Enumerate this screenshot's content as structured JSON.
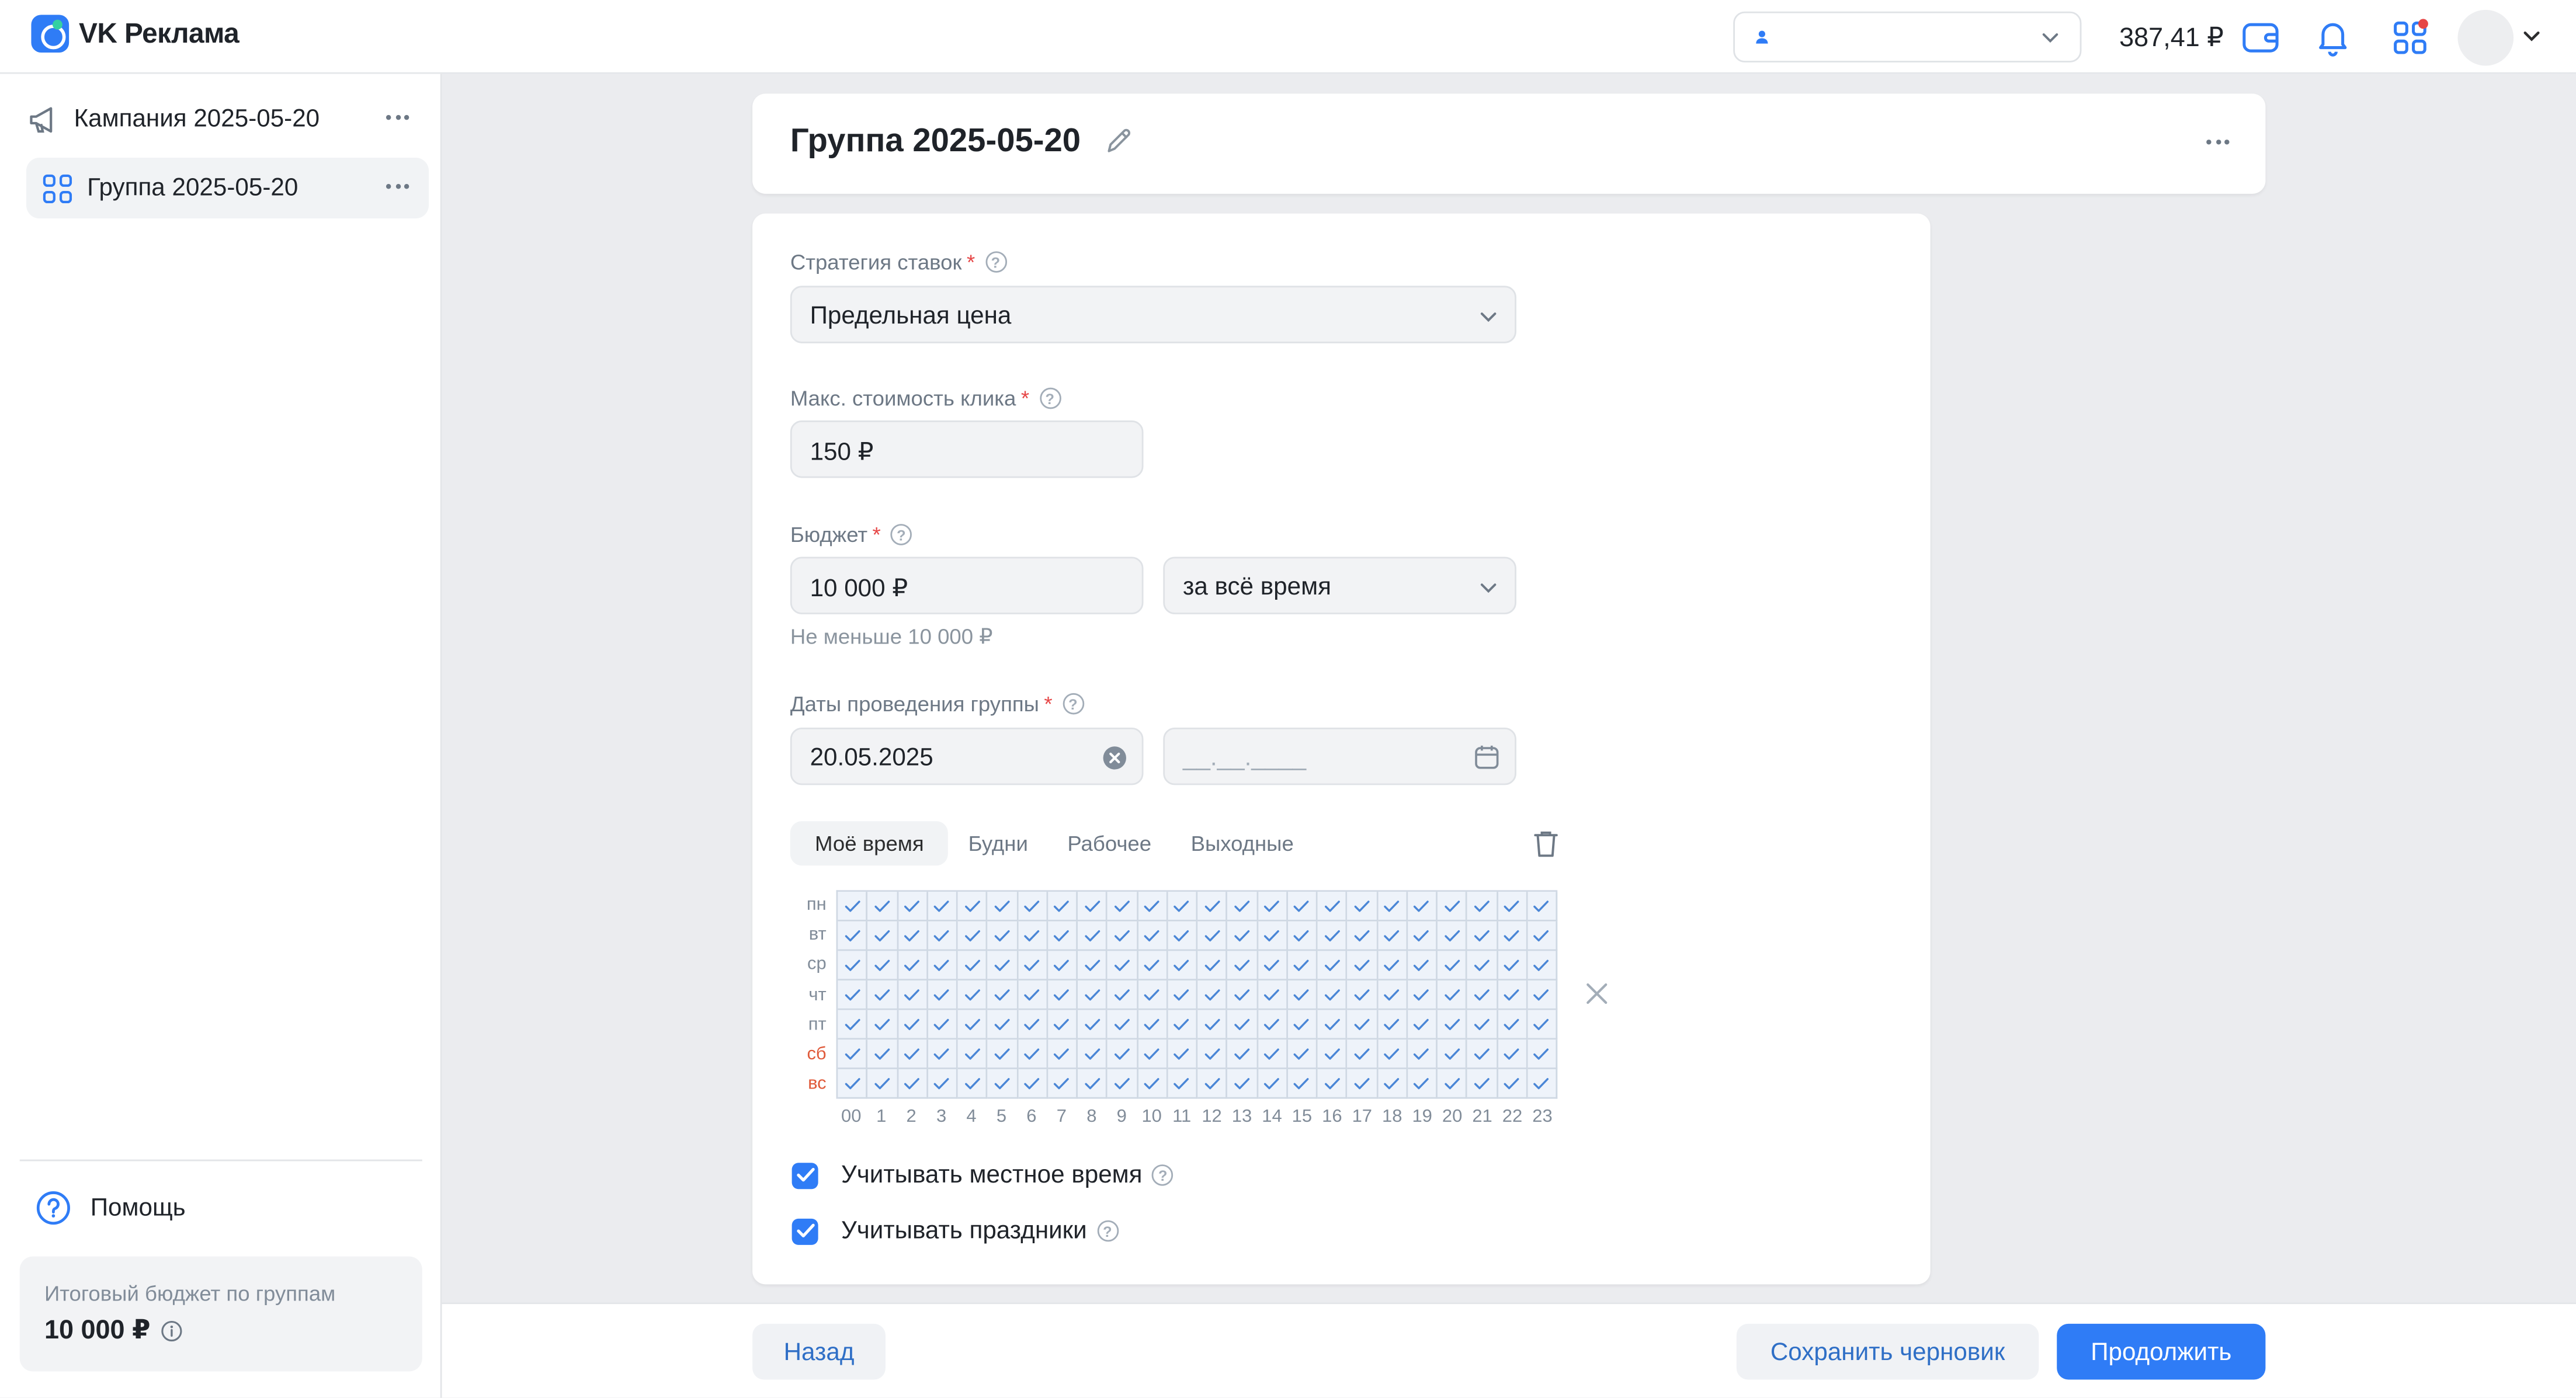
{
  "header": {
    "logo_text": "VK Реклама",
    "balance": "387,41 ₽"
  },
  "sidebar": {
    "items": [
      {
        "label": "Кампания 2025-05-20"
      },
      {
        "label": "Группа 2025-05-20"
      }
    ],
    "help_label": "Помощь",
    "budget_title": "Итоговый бюджет по группам",
    "budget_value": "10 000 ₽"
  },
  "main": {
    "group_title": "Группа 2025-05-20",
    "strategy": {
      "label": "Стратегия ставок",
      "value": "Предельная цена"
    },
    "max_click": {
      "label": "Макс. стоимость клика",
      "value": "150 ₽"
    },
    "budget": {
      "label": "Бюджет",
      "value": "10 000 ₽",
      "period": "за всё время",
      "hint": "Не меньше 10 000 ₽"
    },
    "dates": {
      "label": "Даты проведения группы",
      "start": "20.05.2025",
      "end_placeholder": "__.__.____"
    },
    "schedule_tabs": [
      "Моё время",
      "Будни",
      "Рабочее",
      "Выходные"
    ],
    "days": [
      "пн",
      "вт",
      "ср",
      "чт",
      "пт",
      "сб",
      "вс"
    ],
    "hours": [
      "00",
      "1",
      "2",
      "3",
      "4",
      "5",
      "6",
      "7",
      "8",
      "9",
      "10",
      "11",
      "12",
      "13",
      "14",
      "15",
      "16",
      "17",
      "18",
      "19",
      "20",
      "21",
      "22",
      "23"
    ],
    "checkboxes": [
      {
        "label": "Учитывать местное время",
        "checked": true
      },
      {
        "label": "Учитывать праздники",
        "checked": true
      }
    ]
  },
  "footer": {
    "back": "Назад",
    "save_draft": "Сохранить черновик",
    "continue": "Продолжить"
  },
  "colors": {
    "accent": "#2f7cf6",
    "weekend": "#e05a3a",
    "required": "#e64646"
  }
}
